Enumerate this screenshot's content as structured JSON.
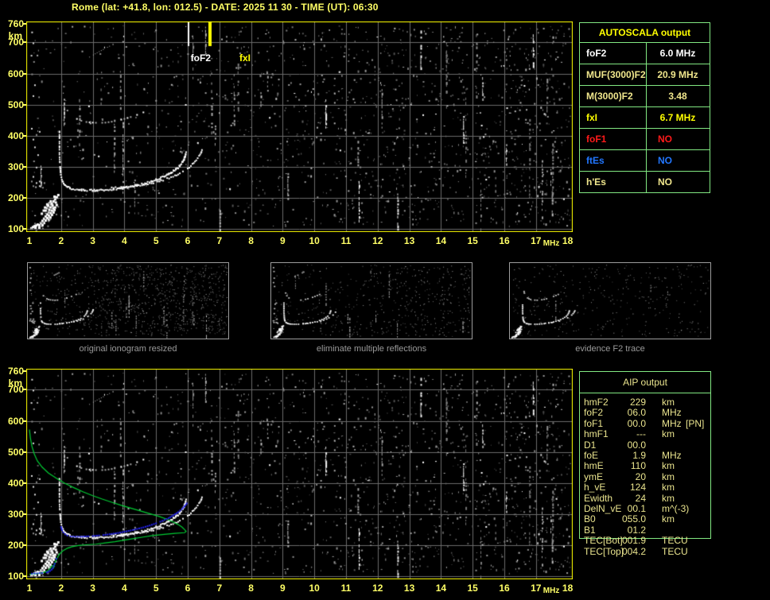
{
  "title": "Rome (lat: +41.8, lon: 012.5) - DATE: 2025 11 30 - TIME (UT): 06:30",
  "colors": {
    "background": "#000000",
    "title_yellow": "#ffff66",
    "axis_yellow": "#ffff66",
    "plot_border_yellow": "#ffff00",
    "grid_gray": "#6b6b6b",
    "table_border_green": "#82e882",
    "table_header_yellow": "#ffff00",
    "khaki": "#f0e68c",
    "aip_khaki": "#eae48e",
    "white": "#ffffff",
    "red": "#ff1a1a",
    "blue": "#2277ff",
    "profile_green": "#00cc33",
    "restored_blue": "#2222ee",
    "caption_gray": "#9a9a9a",
    "thumb_border_gray": "#9d9d9d"
  },
  "autoscala": {
    "header": "AUTOSCALA output",
    "rows": [
      {
        "label": "foF2",
        "value": "6.0 MHz",
        "color": "white"
      },
      {
        "label": "MUF(3000)F2",
        "value": "20.9 MHz",
        "color": "khaki"
      },
      {
        "label": "M(3000)F2",
        "value": "3.48",
        "color": "khaki"
      },
      {
        "label": "fxI",
        "value": "6.7 MHz",
        "color": "yellow"
      },
      {
        "label": "foF1",
        "value": "NO",
        "color": "red"
      },
      {
        "label": "ftEs",
        "value": "NO",
        "color": "blue"
      },
      {
        "label": "h'Es",
        "value": "NO",
        "color": "khaki"
      }
    ]
  },
  "aip": {
    "header": "AIP output",
    "rows": [
      {
        "label": "hmF2",
        "value": "229",
        "unit": "km",
        "extra": ""
      },
      {
        "label": "foF2",
        "value": "06.0",
        "unit": "MHz",
        "extra": ""
      },
      {
        "label": "foF1",
        "value": "00.0",
        "unit": "MHz",
        "extra": "[PN]"
      },
      {
        "label": "hmF1",
        "value": "---",
        "unit": "km",
        "extra": ""
      },
      {
        "label": "D1",
        "value": "00.0",
        "unit": "",
        "extra": ""
      },
      {
        "label": "foE",
        "value": "1.9",
        "unit": "MHz",
        "extra": ""
      },
      {
        "label": "hmE",
        "value": "110",
        "unit": "km",
        "extra": ""
      },
      {
        "label": "ymE",
        "value": "20",
        "unit": "km",
        "extra": ""
      },
      {
        "label": "h_vE",
        "value": "124",
        "unit": "km",
        "extra": ""
      },
      {
        "label": "Ewidth",
        "value": "24",
        "unit": "km",
        "extra": ""
      },
      {
        "label": "DelN_vE",
        "value": "00.1",
        "unit": "m^(-3)",
        "extra": ""
      },
      {
        "label": "B0",
        "value": "055.0",
        "unit": "km",
        "extra": ""
      },
      {
        "label": "B1",
        "value": "01.2",
        "unit": "",
        "extra": ""
      },
      {
        "label": "TEC[Bot]",
        "value": "001.9",
        "unit": "TECU",
        "extra": ""
      },
      {
        "label": "TEC[Top]",
        "value": "004.2",
        "unit": "TECU",
        "extra": ""
      }
    ]
  },
  "thumbnails": [
    {
      "caption": "original ionogram resized",
      "noise_level": 3
    },
    {
      "caption": "eliminate multiple reflections",
      "noise_level": 2
    },
    {
      "caption": "evidence F2 trace",
      "noise_level": 1
    }
  ],
  "chart_data": {
    "type": "scatter",
    "x_unit": "MHz",
    "y_unit": "km",
    "x_ticks": [
      1,
      2,
      3,
      4,
      5,
      6,
      7,
      8,
      9,
      10,
      11,
      12,
      13,
      14,
      15,
      16,
      17,
      18
    ],
    "y_ticks": [
      760,
      700,
      600,
      500,
      400,
      300,
      200,
      100
    ],
    "x_range": [
      1,
      18
    ],
    "y_range": [
      100,
      760
    ],
    "markers": {
      "foF2_label": "foF2",
      "foF2_mhz": 6.0,
      "fxI_label": "fxI",
      "fxI_mhz": 6.7
    },
    "traces": {
      "o_trace": [
        [
          1.95,
          415
        ],
        [
          1.95,
          398
        ],
        [
          1.95,
          382
        ],
        [
          1.95,
          366
        ],
        [
          1.95,
          350
        ],
        [
          1.95,
          334
        ],
        [
          1.96,
          318
        ],
        [
          1.97,
          302
        ],
        [
          1.98,
          288
        ],
        [
          1.99,
          275
        ],
        [
          2.01,
          264
        ],
        [
          2.04,
          254
        ],
        [
          2.08,
          246
        ],
        [
          2.13,
          240
        ],
        [
          2.2,
          235
        ],
        [
          2.28,
          231
        ],
        [
          2.38,
          228
        ],
        [
          2.5,
          226
        ],
        [
          2.65,
          225
        ],
        [
          2.82,
          224
        ],
        [
          3.0,
          224
        ],
        [
          3.2,
          224
        ],
        [
          3.4,
          225
        ],
        [
          3.6,
          227
        ],
        [
          3.8,
          229
        ],
        [
          4.0,
          232
        ],
        [
          4.2,
          236
        ],
        [
          4.4,
          240
        ],
        [
          4.6,
          245
        ],
        [
          4.8,
          251
        ],
        [
          5.0,
          258
        ],
        [
          5.2,
          266
        ],
        [
          5.4,
          276
        ],
        [
          5.55,
          286
        ],
        [
          5.7,
          297
        ],
        [
          5.8,
          309
        ],
        [
          5.87,
          321
        ],
        [
          5.92,
          333
        ],
        [
          5.95,
          345
        ]
      ],
      "x_trace": [
        [
          3.6,
          231
        ],
        [
          3.9,
          233
        ],
        [
          4.2,
          236
        ],
        [
          4.5,
          240
        ],
        [
          4.8,
          246
        ],
        [
          5.1,
          253
        ],
        [
          5.35,
          261
        ],
        [
          5.6,
          271
        ],
        [
          5.8,
          282
        ],
        [
          6.0,
          294
        ],
        [
          6.15,
          307
        ],
        [
          6.27,
          320
        ],
        [
          6.36,
          333
        ],
        [
          6.42,
          345
        ],
        [
          6.45,
          355
        ]
      ],
      "second_hop": [
        [
          2.08,
          520
        ],
        [
          2.1,
          506
        ],
        [
          2.14,
          493
        ],
        [
          2.2,
          481
        ],
        [
          2.28,
          470
        ],
        [
          2.38,
          461
        ],
        [
          2.5,
          454
        ],
        [
          2.64,
          448
        ],
        [
          2.8,
          444
        ],
        [
          3.0,
          442
        ],
        [
          3.2,
          441
        ],
        [
          3.4,
          442
        ],
        [
          3.6,
          445
        ],
        [
          3.8,
          449
        ],
        [
          4.0,
          454
        ],
        [
          4.2,
          460
        ],
        [
          4.4,
          467
        ],
        [
          4.6,
          475
        ],
        [
          4.8,
          484
        ],
        [
          5.0,
          493
        ]
      ],
      "second_hop_right": [
        [
          6.05,
          443
        ],
        [
          6.15,
          452
        ],
        [
          6.25,
          462
        ],
        [
          6.35,
          472
        ],
        [
          6.43,
          481
        ]
      ],
      "upper_diag": [
        [
          2.9,
          653
        ],
        [
          3.02,
          660
        ],
        [
          3.14,
          667
        ],
        [
          3.27,
          674
        ],
        [
          3.4,
          681
        ],
        [
          3.53,
          688
        ],
        [
          3.64,
          695
        ]
      ],
      "e_cluster": [
        [
          1.3,
          113
        ],
        [
          1.35,
          120
        ],
        [
          1.4,
          127
        ],
        [
          1.45,
          134
        ],
        [
          1.5,
          141
        ],
        [
          1.55,
          148
        ],
        [
          1.6,
          155
        ],
        [
          1.62,
          162
        ],
        [
          1.65,
          170
        ],
        [
          1.68,
          177
        ],
        [
          1.7,
          183
        ],
        [
          1.72,
          176
        ],
        [
          1.74,
          168
        ],
        [
          1.7,
          160
        ],
        [
          1.66,
          152
        ],
        [
          1.6,
          144
        ],
        [
          1.55,
          136
        ],
        [
          1.5,
          128
        ],
        [
          1.45,
          120
        ],
        [
          1.4,
          113
        ],
        [
          1.5,
          160
        ],
        [
          1.55,
          168
        ],
        [
          1.58,
          176
        ],
        [
          1.62,
          184
        ],
        [
          1.66,
          190
        ],
        [
          1.55,
          180
        ],
        [
          1.48,
          170
        ],
        [
          1.44,
          160
        ],
        [
          1.38,
          150
        ],
        [
          1.6,
          130
        ],
        [
          1.65,
          138
        ],
        [
          1.7,
          146
        ],
        [
          1.75,
          154
        ],
        [
          1.78,
          162
        ],
        [
          1.8,
          170
        ],
        [
          1.85,
          178
        ],
        [
          1.82,
          186
        ],
        [
          1.05,
          103
        ],
        [
          1.1,
          107
        ],
        [
          1.15,
          110
        ],
        [
          1.2,
          112
        ],
        [
          1.25,
          115
        ],
        [
          1.18,
          105
        ],
        [
          1.3,
          105
        ],
        [
          1.75,
          190
        ],
        [
          1.8,
          196
        ],
        [
          1.85,
          203
        ],
        [
          1.9,
          210
        ],
        [
          1.78,
          205
        ]
      ],
      "left_scatter": [
        [
          1.05,
          255
        ],
        [
          1.1,
          270
        ],
        [
          1.2,
          300
        ],
        [
          1.12,
          320
        ],
        [
          1.3,
          255
        ],
        [
          1.35,
          270
        ],
        [
          1.35,
          295
        ],
        [
          1.25,
          340
        ],
        [
          1.15,
          365
        ],
        [
          1.1,
          390
        ],
        [
          1.2,
          405
        ],
        [
          1.3,
          415
        ],
        [
          1.05,
          425
        ],
        [
          1.45,
          250
        ],
        [
          1.4,
          235
        ],
        [
          1.3,
          240
        ],
        [
          1.2,
          250
        ],
        [
          1.1,
          240
        ],
        [
          1.06,
          735
        ],
        [
          1.1,
          700
        ],
        [
          1.04,
          660
        ],
        [
          1.12,
          640
        ],
        [
          1.06,
          600
        ],
        [
          1.15,
          565
        ],
        [
          1.1,
          530
        ]
      ],
      "streaks": [
        {
          "f": 1.35,
          "k1": 240,
          "k2": 310,
          "bright": false
        },
        {
          "f": 2.08,
          "k1": 440,
          "k2": 525,
          "bright": false
        },
        {
          "f": 6.55,
          "k1": 650,
          "k2": 755,
          "bright": false
        },
        {
          "f": 7.0,
          "k1": 100,
          "k2": 165,
          "bright": false
        },
        {
          "f": 8.3,
          "k1": 480,
          "k2": 560,
          "bright": false
        },
        {
          "f": 9.15,
          "k1": 200,
          "k2": 280,
          "bright": false
        },
        {
          "f": 10.35,
          "k1": 430,
          "k2": 520,
          "bright": true
        },
        {
          "f": 11.4,
          "k1": 130,
          "k2": 260,
          "bright": true
        },
        {
          "f": 12.62,
          "k1": 100,
          "k2": 230,
          "bright": true
        },
        {
          "f": 13.1,
          "k1": 100,
          "k2": 175,
          "bright": true
        },
        {
          "f": 13.35,
          "k1": 620,
          "k2": 755,
          "bright": true
        },
        {
          "f": 14.7,
          "k1": 380,
          "k2": 470,
          "bright": true
        },
        {
          "f": 15.3,
          "k1": 520,
          "k2": 590,
          "bright": false
        },
        {
          "f": 16.05,
          "k1": 300,
          "k2": 380,
          "bright": false
        },
        {
          "f": 16.9,
          "k1": 620,
          "k2": 730,
          "bright": true
        },
        {
          "f": 17.5,
          "k1": 150,
          "k2": 230,
          "bright": false
        }
      ]
    },
    "profile_green": [
      [
        1.0,
        572
      ],
      [
        1.03,
        545
      ],
      [
        1.08,
        518
      ],
      [
        1.15,
        494
      ],
      [
        1.25,
        471
      ],
      [
        1.4,
        451
      ],
      [
        1.6,
        432
      ],
      [
        1.85,
        415
      ],
      [
        2.1,
        400
      ],
      [
        2.4,
        385
      ],
      [
        2.7,
        371
      ],
      [
        3.0,
        359
      ],
      [
        3.3,
        348
      ],
      [
        3.6,
        338
      ],
      [
        3.9,
        328
      ],
      [
        4.2,
        319
      ],
      [
        4.5,
        310
      ],
      [
        4.8,
        301
      ],
      [
        5.1,
        292
      ],
      [
        5.35,
        283
      ],
      [
        5.55,
        274
      ],
      [
        5.7,
        266
      ],
      [
        5.82,
        258
      ],
      [
        5.9,
        250
      ],
      [
        5.95,
        244
      ],
      [
        5.9,
        240
      ],
      [
        5.6,
        238
      ],
      [
        5.2,
        234
      ],
      [
        4.9,
        231
      ],
      [
        4.6,
        226
      ],
      [
        4.3,
        221
      ],
      [
        4.0,
        216
      ],
      [
        3.7,
        211
      ],
      [
        3.4,
        207
      ],
      [
        3.1,
        203
      ],
      [
        2.8,
        201
      ],
      [
        2.55,
        199
      ],
      [
        2.35,
        195
      ],
      [
        2.2,
        190
      ],
      [
        2.05,
        181
      ],
      [
        1.95,
        171
      ],
      [
        1.88,
        159
      ],
      [
        1.83,
        149
      ],
      [
        1.79,
        139
      ],
      [
        1.76,
        130
      ],
      [
        1.73,
        123
      ],
      [
        1.76,
        128
      ],
      [
        1.79,
        132
      ],
      [
        1.72,
        134
      ],
      [
        1.66,
        126
      ],
      [
        1.58,
        117
      ],
      [
        1.48,
        113
      ],
      [
        1.36,
        110
      ],
      [
        1.22,
        108
      ],
      [
        1.1,
        107
      ],
      [
        1.0,
        106
      ]
    ],
    "restored_blue": [
      [
        2.0,
        258
      ],
      [
        2.03,
        248
      ],
      [
        2.07,
        241
      ],
      [
        2.13,
        235
      ],
      [
        2.2,
        231
      ],
      [
        2.3,
        228
      ],
      [
        2.45,
        227
      ],
      [
        2.6,
        227
      ],
      [
        2.8,
        228
      ],
      [
        3.0,
        229
      ],
      [
        3.2,
        231
      ],
      [
        3.4,
        233
      ],
      [
        3.6,
        236
      ],
      [
        3.8,
        239
      ],
      [
        4.0,
        243
      ],
      [
        4.2,
        247
      ],
      [
        4.4,
        252
      ],
      [
        4.6,
        257
      ],
      [
        4.8,
        263
      ],
      [
        5.0,
        270
      ],
      [
        5.2,
        278
      ],
      [
        5.4,
        287
      ],
      [
        5.55,
        296
      ],
      [
        5.7,
        306
      ],
      [
        5.82,
        316
      ],
      [
        5.9,
        325
      ],
      [
        5.97,
        334
      ]
    ],
    "restored_blue_es": [
      [
        1.0,
        108
      ],
      [
        1.08,
        108
      ],
      [
        1.16,
        109
      ],
      [
        1.24,
        109
      ],
      [
        1.32,
        110
      ],
      [
        1.4,
        110
      ],
      [
        1.48,
        111
      ],
      [
        1.55,
        112
      ],
      [
        1.6,
        114
      ],
      [
        1.65,
        117
      ],
      [
        1.7,
        121
      ],
      [
        1.74,
        126
      ],
      [
        1.83,
        147
      ],
      [
        1.85,
        156
      ]
    ]
  }
}
